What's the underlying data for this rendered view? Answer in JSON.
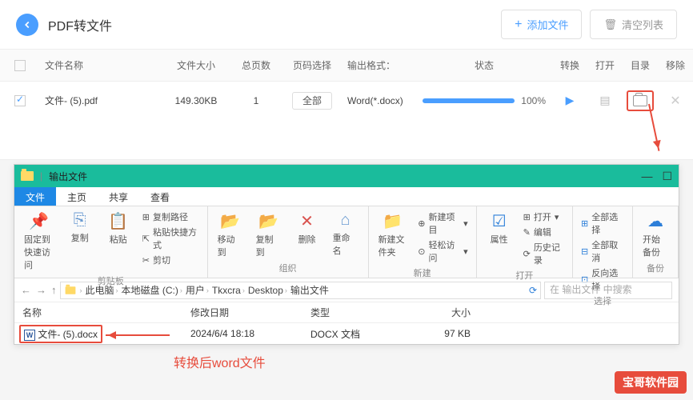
{
  "header": {
    "title": "PDF转文件",
    "add_button": "添加文件",
    "clear_button": "清空列表"
  },
  "table": {
    "headers": {
      "name": "文件名称",
      "size": "文件大小",
      "pages": "总页数",
      "page_select": "页码选择",
      "format": "输出格式：",
      "status": "状态",
      "convert": "转换",
      "open": "打开",
      "dir": "目录",
      "remove": "移除"
    },
    "row": {
      "name": "文件- (5).pdf",
      "size": "149.30KB",
      "pages": "1",
      "select_label": "全部",
      "format": "Word(*.docx)",
      "percent": "100%"
    }
  },
  "explorer": {
    "title": "输出文件",
    "tabs": {
      "file": "文件",
      "home": "主页",
      "share": "共享",
      "view": "查看"
    },
    "ribbon": {
      "pin": "固定到快速访问",
      "copy": "复制",
      "paste": "粘贴",
      "copy_path": "复制路径",
      "paste_shortcut": "粘贴快捷方式",
      "cut": "剪切",
      "clipboard": "剪贴板",
      "move": "移动到",
      "copy_to": "复制到",
      "delete": "删除",
      "rename": "重命名",
      "organize": "组织",
      "new_folder": "新建文件夹",
      "new_item": "新建项目",
      "easy_access": "轻松访问",
      "new": "新建",
      "properties": "属性",
      "open": "打开",
      "edit": "编辑",
      "history": "历史记录",
      "open_group": "打开",
      "select_all": "全部选择",
      "select_none": "全部取消",
      "invert": "反向选择",
      "select": "选择",
      "backup": "开始备份",
      "backup_group": "备份"
    },
    "breadcrumb": {
      "segs": [
        "此电脑",
        "本地磁盘 (C:)",
        "用户",
        "Tkxcra",
        "Desktop",
        "输出文件"
      ],
      "search": "在 输出文件 中搜索"
    },
    "columns": {
      "name": "名称",
      "date": "修改日期",
      "type": "类型",
      "size": "大小"
    },
    "file": {
      "name": "文件- (5).docx",
      "date": "2024/6/4 18:18",
      "type": "DOCX 文档",
      "size": "97 KB"
    }
  },
  "annotation": "转换后word文件",
  "watermark": "宝哥软件园"
}
